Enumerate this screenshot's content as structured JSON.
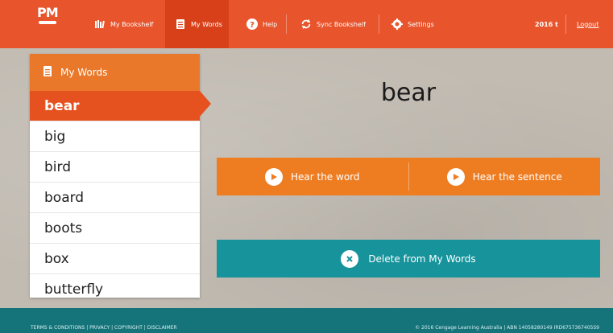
{
  "header": {
    "logo": "PM",
    "nav": [
      {
        "label": "My Bookshelf",
        "icon": "bookshelf-icon"
      },
      {
        "label": "My Words",
        "icon": "notepad-icon",
        "active": true
      },
      {
        "label": "Help",
        "icon": "help-icon"
      },
      {
        "label": "Sync Bookshelf",
        "icon": "sync-icon"
      },
      {
        "label": "Settings",
        "icon": "gear-icon"
      }
    ],
    "user": "2016 t",
    "logout": "Logout"
  },
  "panel": {
    "title": "My Words",
    "words": [
      "bear",
      "big",
      "bird",
      "board",
      "boots",
      "box",
      "butterfly"
    ],
    "selected": "bear"
  },
  "main": {
    "word": "bear",
    "hear_word": "Hear the word",
    "hear_sentence": "Hear the sentence",
    "delete": "Delete from My Words"
  },
  "footer": {
    "left": "TERMS & CONDITIONS  |  PRIVACY  |  COPYRIGHT  |  DISCLAIMER",
    "right": "© 2016 Cengage Learning Australia | ABN 14058280149 IRD6757367405S9"
  },
  "colors": {
    "topbar": "#e8542c",
    "accent_orange": "#ee7d22",
    "teal": "#16939b",
    "footer": "#15737a"
  }
}
